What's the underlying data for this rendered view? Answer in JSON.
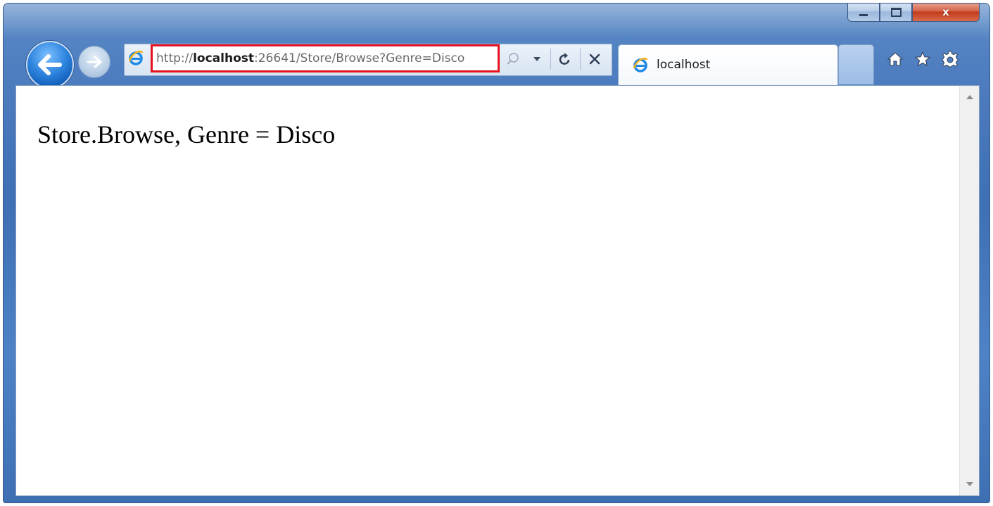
{
  "window": {
    "minimize_icon": "minimize-icon",
    "maximize_icon": "maximize-icon",
    "close_icon": "close-icon",
    "close_glyph": "x"
  },
  "nav": {
    "back_icon": "back-arrow-icon",
    "forward_icon": "forward-arrow-icon"
  },
  "address_bar": {
    "url_prefix": "http://",
    "url_host": "localhost",
    "url_rest": ":26641/Store/Browse?Genre=Disco",
    "highlight_color": "#e8121f",
    "search_icon": "search-icon",
    "dropdown_icon": "chevron-down-icon",
    "refresh_icon": "refresh-icon",
    "stop_icon": "stop-icon"
  },
  "tabs": [
    {
      "label": "localhost",
      "icon": "ie-icon",
      "active": true
    }
  ],
  "toolbar": {
    "home_icon": "home-icon",
    "favorites_icon": "star-icon",
    "tools_icon": "gear-icon"
  },
  "page": {
    "text": "Store.Browse, Genre = Disco"
  },
  "scrollbar": {
    "up_icon": "scroll-up-icon",
    "down_icon": "scroll-down-icon"
  },
  "colors": {
    "frame": "#4f7fc0",
    "close_button": "#c23b1d",
    "accent_blue": "#1e88e5"
  }
}
